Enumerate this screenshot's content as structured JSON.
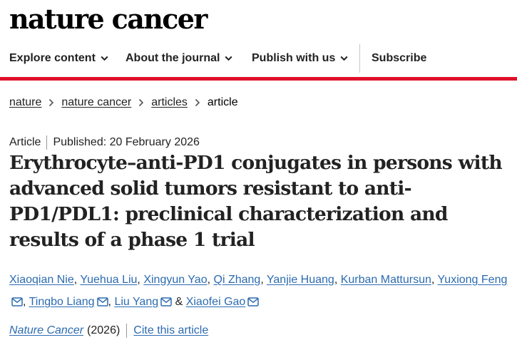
{
  "header": {
    "logo_text": "nature cancer"
  },
  "nav": {
    "items": [
      {
        "label": "Explore content",
        "icon": "chevron-down-icon"
      },
      {
        "label": "About the journal",
        "icon": "chevron-down-icon"
      },
      {
        "label": "Publish with us",
        "icon": "chevron-down-icon"
      }
    ],
    "subscribe_label": "Subscribe",
    "accent_color": "#e0102b"
  },
  "breadcrumb": {
    "items": [
      "nature",
      "nature cancer",
      "articles"
    ],
    "current": "article"
  },
  "article": {
    "type": "Article",
    "published": "Published: 20 February 2026",
    "title": "Erythrocyte–anti-PD1 conjugates in persons with advanced solid tumors resistant to anti-PD1/PDL1: preclinical characterization and results of a phase 1 trial",
    "authors": [
      "Xiaoqian Nie",
      "Yuehua Liu",
      "Xingyun Yao",
      "Qi Zhang",
      "Yanjie Huang",
      "Kurban Mattursun",
      "Yuxiong Feng",
      "Tingbo Liang",
      "Liu Yang",
      "Xiaofei Gao"
    ],
    "author_separator": ",",
    "and_text": "&",
    "link_color": "#2c6bb0",
    "journal": "Nature Cancer",
    "year": "(2026)",
    "cite_label": "Cite this article"
  }
}
